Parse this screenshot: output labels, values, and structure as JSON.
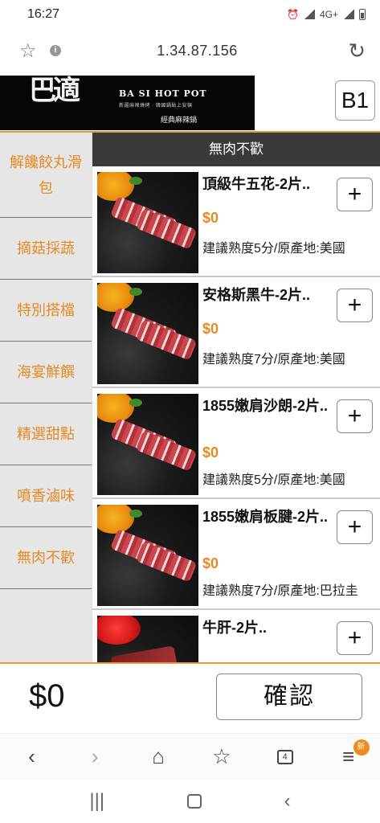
{
  "status_bar": {
    "time": "16:27",
    "network": "4G+"
  },
  "browser": {
    "url": "1.34.87.156"
  },
  "header": {
    "logo_calligraphy": "巴適",
    "logo_brand": "BA SI HOT POT",
    "logo_tagline": "新疆麻辣燒烤 · 韓國鍋貼上安頓",
    "logo_sub": "經典麻辣鍋",
    "table_label": "B1"
  },
  "sidebar": {
    "categories": [
      {
        "label": "解饞餃丸滑包"
      },
      {
        "label": "摘菇採蔬"
      },
      {
        "label": "特別搭檔"
      },
      {
        "label": "海宴鮮饌"
      },
      {
        "label": "精選甜點"
      },
      {
        "label": "噴香滷味"
      },
      {
        "label": "無肉不歡"
      }
    ]
  },
  "content": {
    "section_title": "無肉不歡",
    "items": [
      {
        "name": "頂級牛五花-2片..",
        "price": "$0",
        "desc": "建議熟度5分/原產地:美國"
      },
      {
        "name": "安格斯黑牛-2片..",
        "price": "$0",
        "desc": "建議熟度7分/原產地:美國"
      },
      {
        "name": "1855嫩肩沙朗-2片..",
        "price": "$0",
        "desc": "建議熟度5分/原產地:美國"
      },
      {
        "name": "1855嫩肩板腱-2片..",
        "price": "$0",
        "desc": "建議熟度7分/原產地:巴拉圭"
      },
      {
        "name": "牛肝-2片..",
        "price": "",
        "desc": ""
      }
    ],
    "add_label": "+"
  },
  "footer": {
    "total": "$0",
    "confirm_label": "確認"
  },
  "browser_nav": {
    "badge": "新",
    "tabs_count": "4"
  },
  "colors": {
    "accent": "#e68a24",
    "section_header": "#3a3a3a",
    "sidebar_bg": "#e6e6e6"
  }
}
